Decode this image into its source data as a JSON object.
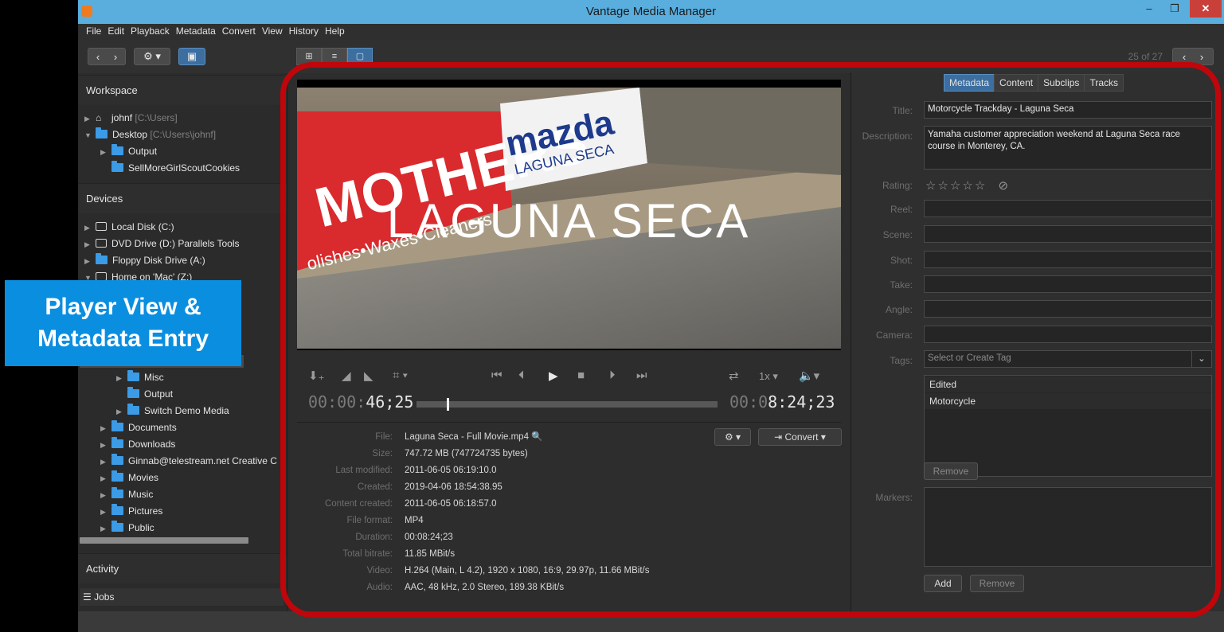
{
  "window": {
    "title": "Vantage Media Manager",
    "min": "–",
    "max": "❐",
    "close": "✕"
  },
  "menu": [
    "File",
    "Edit",
    "Playback",
    "Metadata",
    "Convert",
    "View",
    "History",
    "Help"
  ],
  "toolbar": {
    "counter": "25 of 27"
  },
  "sidebar": {
    "workspace_title": "Workspace",
    "workspace_items": [
      {
        "label": "johnf",
        "path": "[C:\\Users]"
      },
      {
        "label": "Desktop",
        "path": "[C:\\Users\\johnf]"
      },
      {
        "label": "Output",
        "path": ""
      },
      {
        "label": "SellMoreGirlScoutCookies",
        "path": ""
      }
    ],
    "devices_title": "Devices",
    "device_items": [
      {
        "label": "Local Disk (C:)"
      },
      {
        "label": "DVD Drive (D:) Parallels Tools"
      },
      {
        "label": "Floppy Disk Drive (A:)"
      },
      {
        "label": "Home on 'Mac' (Z:)"
      },
      {
        "label": "Misc"
      },
      {
        "label": "Output"
      },
      {
        "label": "Switch Demo Media"
      },
      {
        "label": "Documents"
      },
      {
        "label": "Downloads"
      },
      {
        "label": "Ginnab@telestream.net Creative C"
      },
      {
        "label": "Movies"
      },
      {
        "label": "Music"
      },
      {
        "label": "Pictures"
      },
      {
        "label": "Public"
      }
    ],
    "activity_title": "Activity",
    "jobs_label": "Jobs"
  },
  "player": {
    "video_text": "LAGUNA  SECA",
    "banner_left": "MOTHERS",
    "banner_sub": "olishes•Waxes•Cleaners",
    "banner_right": "mazda",
    "banner_right_sub": "LAGUNA SECA",
    "speed": "1x",
    "current_dim": "00:00:",
    "current_bright": "46;25",
    "total_dim": "00:0",
    "total_bright": "8:24;23",
    "progress": 0.1
  },
  "file_info": [
    {
      "label": "File:",
      "value": "Laguna Seca - Full Movie.mp4"
    },
    {
      "label": "Size:",
      "value": "747.72 MB (747724735 bytes)"
    },
    {
      "label": "Last modified:",
      "value": "2011-06-05 06:19:10.0"
    },
    {
      "label": "Created:",
      "value": "2019-04-06 18:54:38.95"
    },
    {
      "label": "Content created:",
      "value": "2011-06-05 06:18:57.0"
    },
    {
      "label": "File format:",
      "value": "MP4"
    },
    {
      "label": "Duration:",
      "value": "00:08:24;23"
    },
    {
      "label": "Total bitrate:",
      "value": "11.85 MBit/s"
    },
    {
      "label": "Video:",
      "value": "H.264 (Main, L 4.2), 1920 x 1080, 16:9, 29.97p, 11.66 MBit/s"
    },
    {
      "label": "Audio:",
      "value": "AAC, 48 kHz, 2.0 Stereo, 189.38 KBit/s"
    }
  ],
  "convert_label": "Convert",
  "tabs": [
    "Metadata",
    "Content",
    "Subclips",
    "Tracks"
  ],
  "metadata": {
    "title_label": "Title:",
    "title_value": "Motorcycle Trackday - Laguna Seca",
    "description_label": "Description:",
    "description_value": "Yamaha customer appreciation weekend at Laguna Seca race course in Monterey, CA.",
    "rating_label": "Rating:",
    "rating_value": 0,
    "rating_max": 5,
    "fields": [
      "Reel:",
      "Scene:",
      "Shot:",
      "Take:",
      "Angle:",
      "Camera:"
    ],
    "tags_label": "Tags:",
    "tags_placeholder": "Select or Create Tag",
    "tags": [
      "Edited",
      "Motorcycle"
    ],
    "remove_label": "Remove",
    "markers_label": "Markers:",
    "add_label": "Add",
    "remove2_label": "Remove"
  },
  "callout": {
    "line1": "Player View &",
    "line2": "Metadata Entry"
  },
  "colors": {
    "accent": "#3c6fa0",
    "titlebar": "#5aaedd",
    "highlight": "#c0060a",
    "callout": "#0a8ee0",
    "folder": "#3b9be6"
  }
}
